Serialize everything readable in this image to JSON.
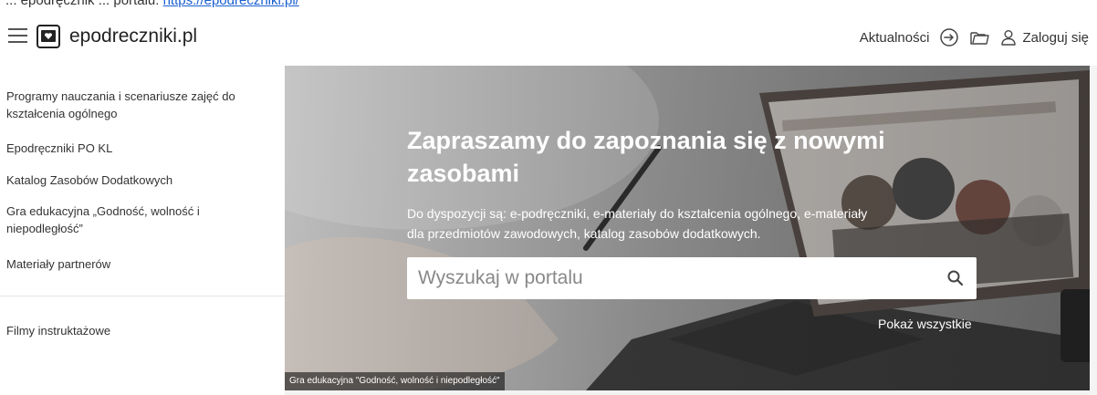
{
  "topline": {
    "text": "... epodręcznik ... portalu:",
    "link": "https://epodreczniki.pl/"
  },
  "header": {
    "logo_text": "epodreczniki.pl",
    "nav": {
      "news_label": "Aktualności",
      "login_label": "Zaloguj się"
    },
    "icons": [
      "menu-icon",
      "logo-icon",
      "sign-in-icon",
      "folder-icon",
      "user-icon"
    ]
  },
  "sidebar": {
    "items": [
      {
        "label": "Programy nauczania i scenariusze zajęć do kształcenia ogólnego"
      },
      {
        "label": "Epodręczniki PO KL"
      },
      {
        "label": "Katalog Zasobów Dodatkowych"
      },
      {
        "label": "Gra edukacyjna „Godność, wolność i niepodległość”"
      },
      {
        "label": "Materiały partnerów"
      },
      {
        "label": "Filmy instruktażowe"
      }
    ]
  },
  "hero": {
    "title": "Zapraszamy do zapoznania się z nowymi zasobami",
    "description": "Do dyspozycji są: e-podręczniki, e-materiały do kształcenia ogólnego, e-materiały dla przedmiotów zawodowych, katalog zasobów dodatkowych.",
    "search": {
      "placeholder": "Wyszukaj w portalu",
      "value": ""
    },
    "show_all_label": "Pokaż wszystkie",
    "caption": "Gra edukacyjna \"Godność, wolność i niepodległość\""
  },
  "colors": {
    "link": "#1a5fd0",
    "text": "#333333",
    "hero_text": "#ffffff"
  }
}
